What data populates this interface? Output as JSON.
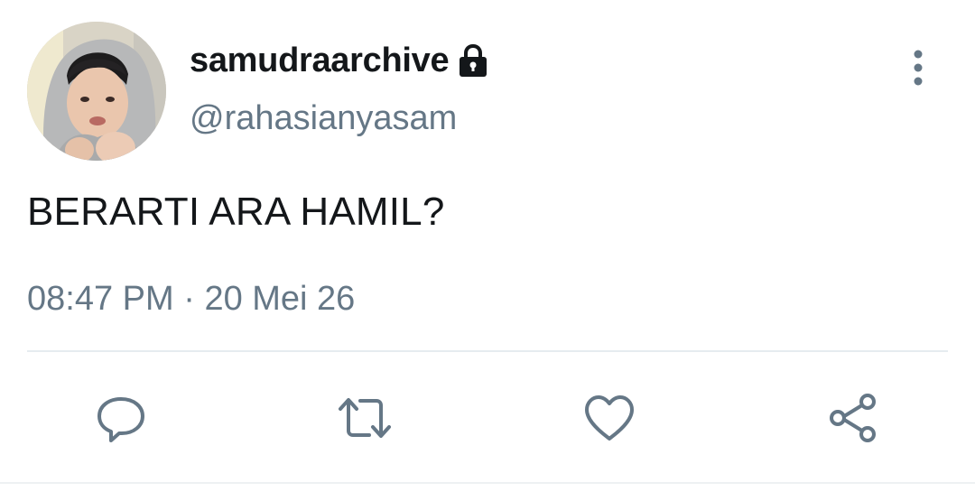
{
  "user": {
    "display_name": "samudraarchive",
    "handle": "@rahasianyasam",
    "protected": true,
    "avatar_icon": "profile-photo"
  },
  "tweet": {
    "text": "BERARTI ARA HAMIL?",
    "time": "08:47 PM",
    "separator": " · ",
    "date": "20 Mei 26"
  },
  "actions": {
    "reply_icon": "speech-bubble-icon",
    "retweet_icon": "retweet-arrows-icon",
    "like_icon": "heart-icon",
    "share_icon": "share-nodes-icon"
  },
  "colors": {
    "text_primary": "#14171a",
    "text_secondary": "#657786",
    "icon": "#657786",
    "divider": "#e6ecf0"
  }
}
